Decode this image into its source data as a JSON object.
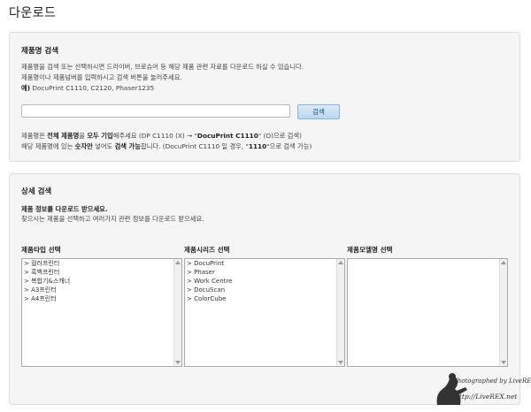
{
  "page": {
    "title": "다운로드"
  },
  "search": {
    "heading": "제품명 검색",
    "desc1": "제품명을 검색 또는 선택하시면 드라이버, 브로슈어 등 해당 제품 관련 자료를 다운로드 하실 수 있습니다.",
    "desc2": "제품명이나 제품넘버를 입력하시고 검색 버튼을 눌러주세요.",
    "example_prefix": "예)",
    "example_text": "DocuPrint C1110, C2120, Phaser1235",
    "input_value": "",
    "button_label": "검색",
    "note1_a": "제품명은 ",
    "note1_b": "전체 제품명",
    "note1_c": "을 ",
    "note1_d": "모두 기입",
    "note1_e": "해주세요 (DP C1110 (X) → \"",
    "note1_f": "DocuPrint C1110",
    "note1_g": "\" (O)으로 검색)",
    "note2_a": "해당 제품명에 있는 ",
    "note2_b": "숫자만",
    "note2_c": " 넣어도 ",
    "note2_d": "검색 가능",
    "note2_e": "합니다. (DocuPrint C1110 일 경우, \"",
    "note2_f": "1110",
    "note2_g": "\"으로 검색 가능)"
  },
  "detail": {
    "heading": "상세 검색",
    "sub": "제품 정보를 다운로드 받으세요.",
    "desc": "찾으시는 제품을 선택하고 여러가지 관련 정보를 다운로드 받으세요.",
    "type_label": "제품타입 선택",
    "type_options": [
      "> 컬러프린터",
      "> 흑백프린터",
      "> 복합기&스캐너",
      "> A3프린터",
      "> A4프린터"
    ],
    "series_label": "제품시리즈 선택",
    "series_options": [
      "> DocuPrint",
      "> Phaser",
      "> Work Centre",
      "> DocuScan",
      "> ColorCube"
    ],
    "model_label": "제품모델명 선택",
    "model_options": []
  },
  "watermark": {
    "text": "Photographed by LiveREX",
    "url": "http://LiveREX.net"
  }
}
